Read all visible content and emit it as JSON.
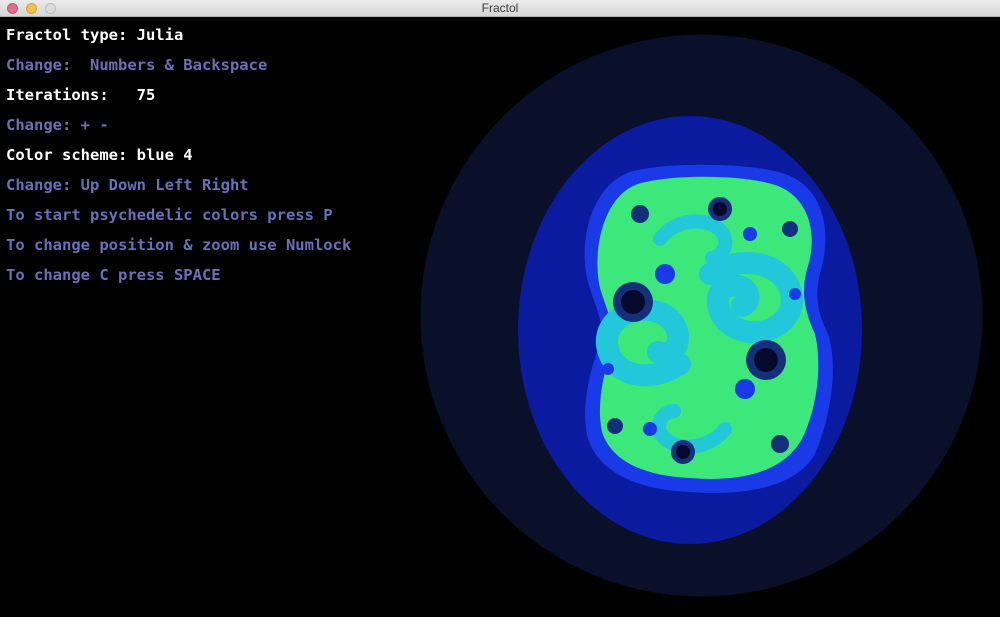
{
  "window": {
    "title": "Fractol"
  },
  "hud": {
    "lines": [
      {
        "text": "Fractol type: Julia",
        "color": "#ffffff"
      },
      {
        "text": "Change:  Numbers & Backspace",
        "color": "#6b6fb8"
      },
      {
        "text": "Iterations:   75",
        "color": "#ffffff"
      },
      {
        "text": "Change: + -",
        "color": "#6b6fb8"
      },
      {
        "text": "Color scheme: blue 4",
        "color": "#ffffff"
      },
      {
        "text": "Change: Up Down Left Right",
        "color": "#6b6fb8"
      },
      {
        "text": "To start psychedelic colors press P",
        "color": "#6b6fb8"
      },
      {
        "text": "To change position & zoom use Numlock",
        "color": "#6b6fb8"
      },
      {
        "text": "To change C press SPACE",
        "color": "#6b6fb8"
      }
    ]
  },
  "colors": {
    "background": "#000000",
    "outer_ring": "#0a0f2a",
    "inner_ring": "#0a1ba0",
    "band_blue": "#1a3ae8",
    "band_green": "#3be879",
    "band_cyan": "#22c7d9",
    "core_dark": "#060a2a"
  }
}
